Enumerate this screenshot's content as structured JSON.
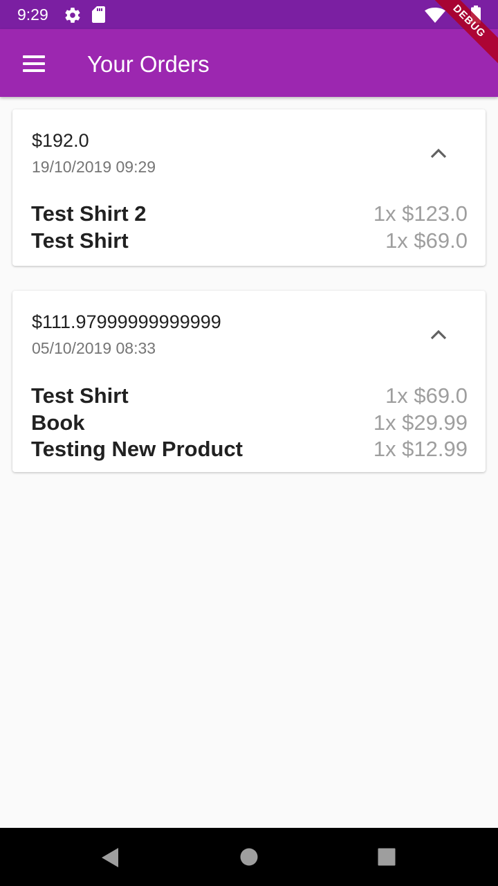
{
  "status_bar": {
    "time": "9:29",
    "icons": [
      "gear-icon",
      "sd-card-icon",
      "wifi-icon",
      "battery-icon"
    ]
  },
  "app_bar": {
    "title": "Your Orders",
    "menu_icon": "menu-icon"
  },
  "debug_banner": "DEBUG",
  "colors": {
    "status_bar": "#7b1fa2",
    "app_bar": "#9c27b0",
    "background": "#fafafa"
  },
  "orders": [
    {
      "total": "$192.0",
      "date": "19/10/2019 09:29",
      "items": [
        {
          "name": "Test Shirt 2",
          "qty_price": "1x $123.0"
        },
        {
          "name": "Test Shirt",
          "qty_price": "1x $69.0"
        }
      ]
    },
    {
      "total": "$111.97999999999999",
      "date": "05/10/2019 08:33",
      "items": [
        {
          "name": "Test Shirt",
          "qty_price": "1x $69.0"
        },
        {
          "name": "Book",
          "qty_price": "1x $29.99"
        },
        {
          "name": "Testing New Product",
          "qty_price": "1x $12.99"
        }
      ]
    }
  ],
  "nav_bar": [
    "back-icon",
    "home-icon",
    "recents-icon"
  ]
}
